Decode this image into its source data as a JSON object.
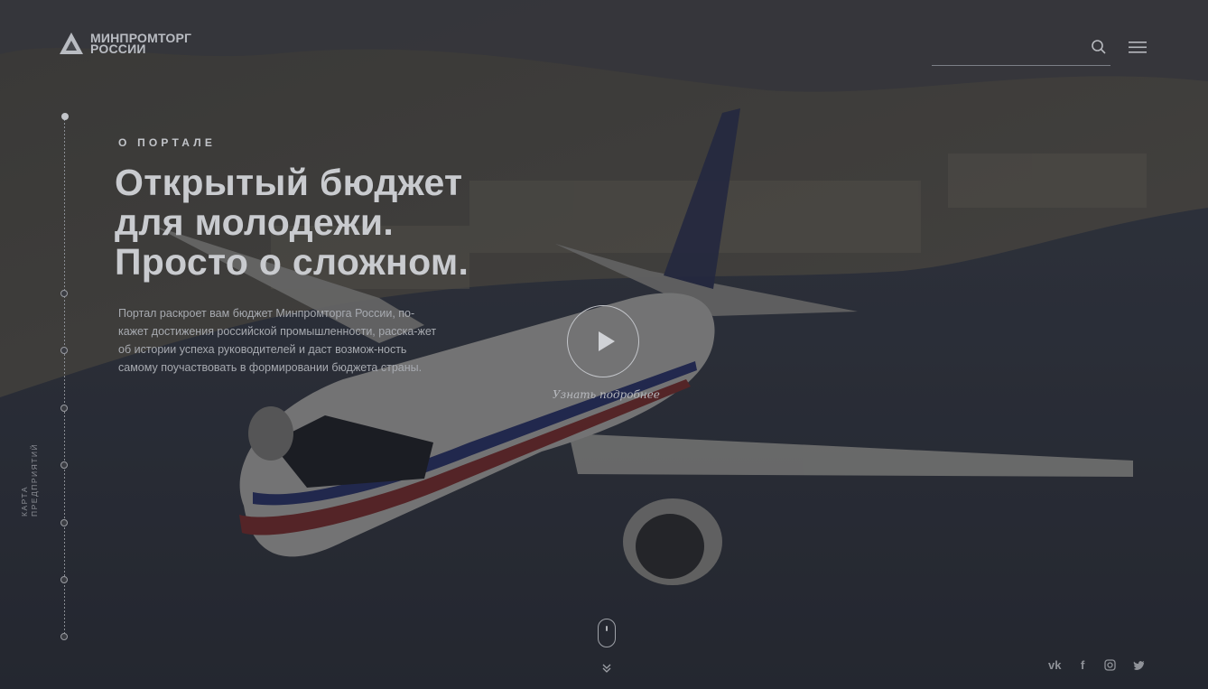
{
  "logo": {
    "line1": "МИНПРОМТОРГ",
    "line2": "РОССИИ"
  },
  "header": {
    "search_icon": "search-icon",
    "menu_icon": "hamburger-menu-icon"
  },
  "sidebar": {
    "label_line1": "КАРТА",
    "label_line2": "ПРЕДПРИЯТИЙ",
    "dot_count": 8,
    "active_index": 0
  },
  "hero": {
    "eyebrow": "О ПОРТАЛЕ",
    "title_lines": [
      "Открытый бюджет",
      "для молодежи.",
      "Просто о сложном."
    ],
    "description": "Портал раскроет вам бюджет Минпромторга России, по-кажет достижения российской промышленности, расска-жет об истории успеха руководителей и даст возмож-ность самому поучаствовать в формировании бюджета страны.",
    "play_label": "Узнать подробнее"
  },
  "social": {
    "vk": "vk",
    "facebook": "f",
    "instagram": "instagram-icon",
    "twitter": "twitter-icon"
  },
  "colors": {
    "overlay": "#1b1d22",
    "text": "#c9cbcf",
    "muted": "#a7aab0"
  }
}
